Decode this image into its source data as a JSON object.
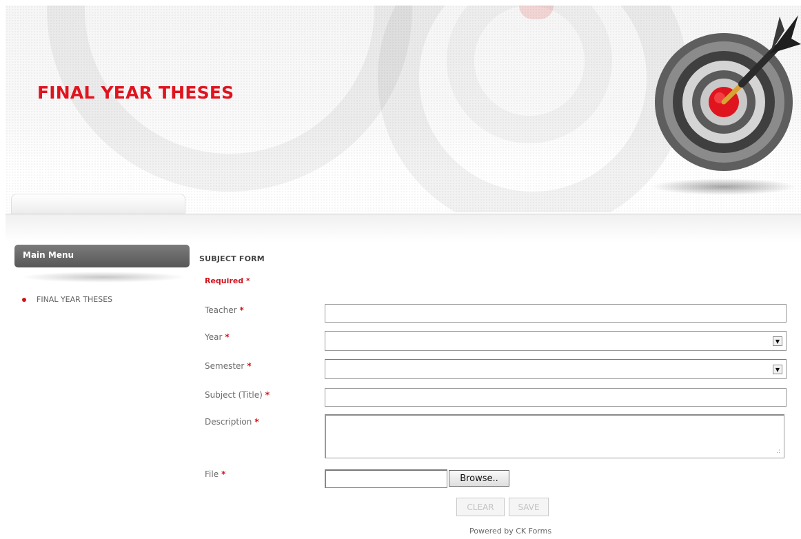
{
  "header": {
    "site_title": "FINAL YEAR THESES"
  },
  "sidebar": {
    "menu_title": "Main Menu",
    "items": [
      {
        "label": "FINAL YEAR THESES"
      }
    ]
  },
  "form": {
    "title": "SUBJECT FORM",
    "required_note": "Required",
    "required_marker": "*",
    "fields": {
      "teacher": {
        "label": "Teacher",
        "value": ""
      },
      "year": {
        "label": "Year",
        "selected": ""
      },
      "semester": {
        "label": "Semester",
        "selected": ""
      },
      "subject": {
        "label": "Subject (Title)",
        "value": ""
      },
      "description": {
        "label": "Description",
        "value": ""
      },
      "file": {
        "label": "File",
        "value": ""
      }
    },
    "browse_label": "Browse..",
    "clear_label": "CLEAR",
    "save_label": "SAVE"
  },
  "footer": {
    "powered_by": "Powered by CK Forms"
  },
  "colors": {
    "brand_red": "#e0141e",
    "menu_header": "#666666",
    "text": "#6b6b6b"
  },
  "icons": {
    "logo": "target-dart-icon",
    "select_arrow": "chevron-down-icon",
    "bullet": "bullet-dot-icon",
    "resize": "resize-grip-icon"
  }
}
